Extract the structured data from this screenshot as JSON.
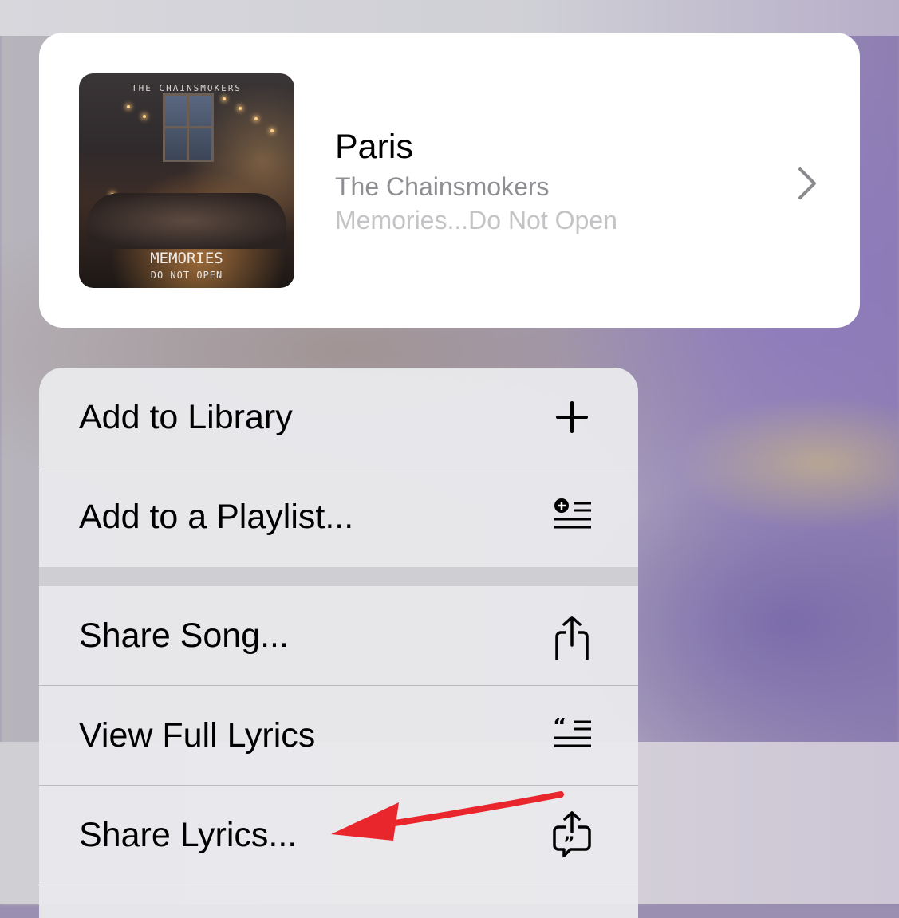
{
  "song": {
    "title": "Paris",
    "artist": "The Chainsmokers",
    "album": "Memories...Do Not Open",
    "artwork": {
      "band_text": "THE CHAINSMOKERS",
      "title_text": "MEMORIES",
      "subtitle_text": "DO NOT OPEN"
    }
  },
  "menu": {
    "items": [
      {
        "label": "Add to Library",
        "icon": "plus-icon"
      },
      {
        "label": "Add to a Playlist...",
        "icon": "add-to-playlist-icon"
      },
      {
        "label": "Share Song...",
        "icon": "share-icon"
      },
      {
        "label": "View Full Lyrics",
        "icon": "lyrics-icon"
      },
      {
        "label": "Share Lyrics...",
        "icon": "share-lyrics-icon"
      }
    ]
  },
  "annotation": {
    "color": "#e8262c",
    "icon": "red-arrow"
  }
}
